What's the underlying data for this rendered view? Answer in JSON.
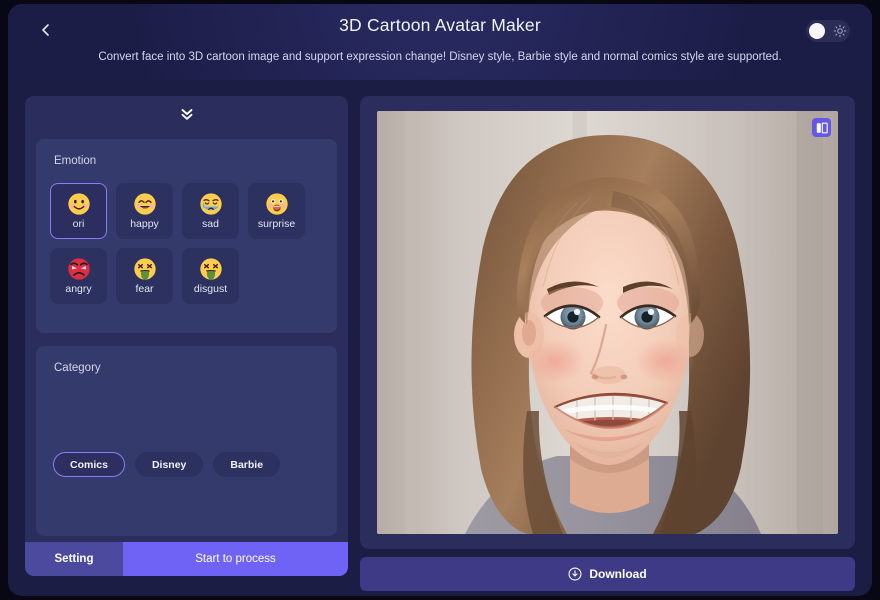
{
  "header": {
    "back_icon": "chevron-left-icon",
    "title": "3D Cartoon Avatar Maker",
    "subtitle": "Convert face into 3D cartoon image and support expression change! Disney style, Barbie style and normal comics style are supported.",
    "theme_toggle": {
      "state": "light",
      "icon": "sun-icon"
    }
  },
  "left_panel": {
    "collapse_icon": "double-chevron-down-icon",
    "emotion": {
      "title": "Emotion",
      "options": [
        {
          "label": "ori",
          "emoji": "slightly-smiling-face",
          "selected": true
        },
        {
          "label": "happy",
          "emoji": "smiling-face-with-smiling-eyes",
          "selected": false
        },
        {
          "label": "sad",
          "emoji": "crying-face",
          "selected": false
        },
        {
          "label": "surprise",
          "emoji": "astonished-face",
          "selected": false
        },
        {
          "label": "angry",
          "emoji": "pouting-face",
          "selected": false
        },
        {
          "label": "fear",
          "emoji": "face-vomiting",
          "selected": false
        },
        {
          "label": "disgust",
          "emoji": "face-vomiting",
          "selected": false
        }
      ]
    },
    "category": {
      "title": "Category",
      "options": [
        {
          "label": "Comics",
          "selected": true
        },
        {
          "label": "Disney",
          "selected": false
        },
        {
          "label": "Barbie",
          "selected": false
        }
      ]
    },
    "footer": {
      "setting_label": "Setting",
      "process_label": "Start to process"
    }
  },
  "right_panel": {
    "compare_icon": "compare-split-view-icon",
    "preview_alt": "3D cartoon avatar of a smiling young woman with long brown hair",
    "download_label": "Download",
    "download_icon": "download-circle-icon"
  },
  "colors": {
    "page_bg": "#070814",
    "app_bg": "#1b1d44",
    "header_bg": "#1e1f4c",
    "panel_bg": "#2b2e5c",
    "card_bg": "#343a6b",
    "tile_bg": "#2d3160",
    "accent": "#6f63f5",
    "accent_border": "#8b7bf8",
    "setting_bg": "#4b4a9e",
    "download_bg": "#3f3a86"
  }
}
